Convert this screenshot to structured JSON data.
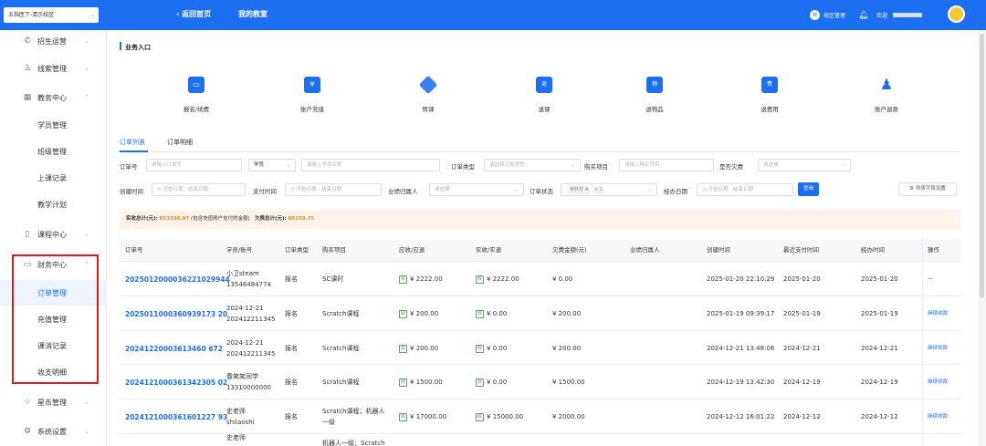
{
  "top": {
    "campus": "五指医下-清示校区",
    "back": "返回首页",
    "my_classroom": "我的教室",
    "campus_manage": "校区管理",
    "welcome": "欢迎"
  },
  "sidebar": {
    "items": [
      {
        "label": "招生运营",
        "icon": "phone-icon",
        "glyph": "✆"
      },
      {
        "label": "线索管理",
        "icon": "user-icon",
        "glyph": "♙"
      },
      {
        "label": "教务中心",
        "icon": "building-icon",
        "glyph": "▦"
      },
      {
        "label": "学员管理"
      },
      {
        "label": "班级管理"
      },
      {
        "label": "上课记录"
      },
      {
        "label": "教学计划"
      },
      {
        "label": "课程中心",
        "icon": "book-icon",
        "glyph": "▯"
      },
      {
        "label": "财务中心",
        "icon": "wallet-icon",
        "glyph": "▭"
      },
      {
        "label": "订单管理"
      },
      {
        "label": "充值管理"
      },
      {
        "label": "课消记录"
      },
      {
        "label": "收支明细"
      },
      {
        "label": "星币管理",
        "icon": "star-icon",
        "glyph": "☆"
      },
      {
        "label": "系统设置",
        "icon": "gear-icon",
        "glyph": "⚙"
      }
    ]
  },
  "section_title": "业务入口",
  "quick_actions": [
    {
      "label": "报名/续费",
      "icon": "monitor-icon",
      "glyph": "▭"
    },
    {
      "label": "账户充值",
      "icon": "yen-card-icon",
      "glyph": "¥"
    },
    {
      "label": "转课",
      "icon": "layers-transfer-icon",
      "glyph": "◈"
    },
    {
      "label": "退课",
      "icon": "layers-return-icon",
      "glyph": "退"
    },
    {
      "label": "退物品",
      "icon": "goods-icon",
      "glyph": "物"
    },
    {
      "label": "退费用",
      "icon": "fee-icon",
      "glyph": "费"
    },
    {
      "label": "账户退款",
      "icon": "user-refund-icon",
      "glyph": "♟"
    }
  ],
  "tabs": [
    "订单列表",
    "订单明细"
  ],
  "filters": {
    "order_no_label": "订单号",
    "order_no_ph": "请输入订单号",
    "student_select": "学员",
    "student_ph": "请输入学员名称",
    "order_type_label": "订单类型",
    "order_type_ph": "请选择订单类型",
    "purchase_label": "购买项目",
    "purchase_ph": "请输入购买项目",
    "debt_label": "是否欠费",
    "debt_ph": "请选择",
    "create_time_label": "创建时间",
    "pay_time_label": "支付时间",
    "date_range_ph": "开始日期 - 结束日期",
    "owner_label": "业绩归属人",
    "owner_ph": "请选择",
    "status_label": "订单状态",
    "status_tag": "待补交",
    "status_more": "+ 1",
    "handle_date_label": "经办日期",
    "query": "查询",
    "column_settings": "列表字段设置"
  },
  "summary": {
    "received_label": "实收总计(元):",
    "received_value": "853336.07",
    "received_note": "(包含充值账户支付的金额)",
    "debt_label": "欠费总计(元):",
    "debt_value": "80259.75"
  },
  "table": {
    "headers": [
      "订单号",
      "学员/账号",
      "订单类型",
      "购买项目",
      "应收/应退",
      "实收/实退",
      "欠费金额(元)",
      "业绩归属人",
      "创建时间",
      "最近支付时间",
      "经办时间",
      "操作"
    ],
    "pay_tag": "收",
    "rows": [
      {
        "order": "2025012000036221029944",
        "student": "小卫steam",
        "account": "13546484774",
        "type": "报名",
        "item": "SC课时",
        "item2": "",
        "due": "¥ 2222.00",
        "paid": "¥ 2222.00",
        "debt": "¥ 0.00",
        "owner": "",
        "created": "2025-01-20 22:10:29",
        "last_pay": "2025-01-20",
        "handled": "2025-01-20",
        "op": "--"
      },
      {
        "order": "2025011000360939173 20",
        "student": "2024-12-21",
        "account": "202412211345",
        "type": "报名",
        "item": "Scratch课程",
        "item2": "",
        "due": "¥ 200.00",
        "paid": "¥ 0.00",
        "debt": "¥ 200.00",
        "owner": "",
        "created": "2025-01-19 09:39:17",
        "last_pay": "2025-01-19",
        "handled": "2025-01-19",
        "op": "继续收款"
      },
      {
        "order": "20241220003613460 672",
        "student": "2024-12-21",
        "account": "202412211345",
        "type": "报名",
        "item": "Scratch课程",
        "item2": "",
        "due": "¥ 200.00",
        "paid": "¥ 0.00",
        "debt": "¥ 200.00",
        "owner": "",
        "created": "2024-12-21 13:48:06",
        "last_pay": "2024-12-21",
        "handled": "2024-12-21",
        "op": "继续收款"
      },
      {
        "order": "2024121000361342305 02",
        "student": "春笑笑同学",
        "account": "13310000000",
        "type": "报名",
        "item": "Scratch课程",
        "item2": "",
        "due": "¥ 1500.00",
        "paid": "¥ 0.00",
        "debt": "¥ 1500.00",
        "owner": "",
        "created": "2024-12-19 13:42:30",
        "last_pay": "2024-12-19",
        "handled": "2024-12-19",
        "op": "继续收款"
      },
      {
        "order": "2024121000361601227 93",
        "student": "史老师",
        "account": "shilaoshi",
        "type": "报名",
        "item": "Scratch课程；机器人",
        "item2": "一级",
        "due": "¥ 17000.00",
        "paid": "¥ 15000.00",
        "debt": "¥ 2000.00",
        "owner": "",
        "created": "2024-12-12 16:01:22",
        "last_pay": "2024-12-12",
        "handled": "2024-12-12",
        "op": "继续收款"
      },
      {
        "order": "",
        "student": "史老师",
        "account": "",
        "type": "",
        "item": "机器人一级；Scratch",
        "item2": "",
        "due": "",
        "paid": "",
        "debt": "",
        "owner": "",
        "created": "",
        "last_pay": "",
        "handled": "",
        "op": ""
      }
    ]
  },
  "colors": {
    "primary": "#1d6ff2",
    "highlight_box": "#e31a1a",
    "amount": "#f0842c",
    "pay_tag": "#4caf50"
  }
}
